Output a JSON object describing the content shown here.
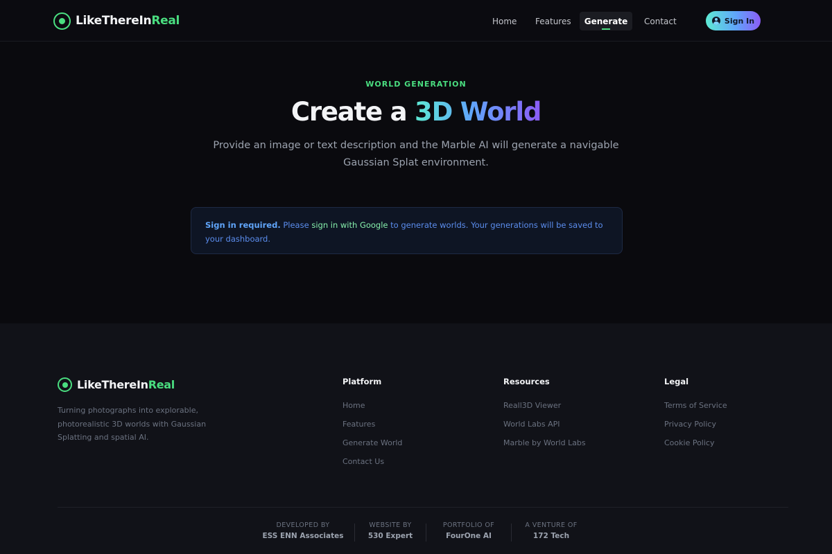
{
  "header": {
    "brand": {
      "name_main": "LikeThereIn",
      "name_accent": "Real"
    },
    "nav": [
      {
        "label": "Home",
        "active": false
      },
      {
        "label": "Features",
        "active": false
      },
      {
        "label": "Generate",
        "active": true
      },
      {
        "label": "Contact",
        "active": false
      }
    ],
    "signin_label": "Sign In"
  },
  "hero": {
    "eyebrow": "WORLD GENERATION",
    "title_plain": "Create a ",
    "title_accent": "3D World",
    "subtitle": "Provide an image or text description and the Marble AI will generate a navigable Gaussian Splat environment.",
    "notice": {
      "strong": "Sign in required.",
      "text_before": " Please ",
      "link": "sign in with Google",
      "text_after": " to generate worlds. Your generations will be saved to your dashboard."
    }
  },
  "footer": {
    "brand": {
      "name_main": "LikeThereIn",
      "name_accent": "Real"
    },
    "description": "Turning photographs into explorable, photorealistic 3D worlds with Gaussian Splatting and spatial AI.",
    "columns": [
      {
        "title": "Platform",
        "links": [
          "Home",
          "Features",
          "Generate World",
          "Contact Us"
        ]
      },
      {
        "title": "Resources",
        "links": [
          "Reall3D Viewer",
          "World Labs API",
          "Marble by World Labs"
        ]
      },
      {
        "title": "Legal",
        "links": [
          "Terms of Service",
          "Privacy Policy",
          "Cookie Policy"
        ]
      }
    ],
    "credits": [
      {
        "label": "DEVELOPED BY",
        "value": "ESS ENN Associates"
      },
      {
        "label": "WEBSITE BY",
        "value": "530 Expert"
      },
      {
        "label": "PORTFOLIO OF",
        "value": "FourOne AI"
      },
      {
        "label": "A VENTURE OF",
        "value": "172 Tech"
      }
    ]
  },
  "colors": {
    "accent_green": "#4ade80",
    "accent_blue": "#60a5fa",
    "accent_purple": "#8b5cf6",
    "background": "#0a0a0e",
    "footer_background": "#111218"
  },
  "icons": [
    "logo-icon",
    "user-icon"
  ]
}
